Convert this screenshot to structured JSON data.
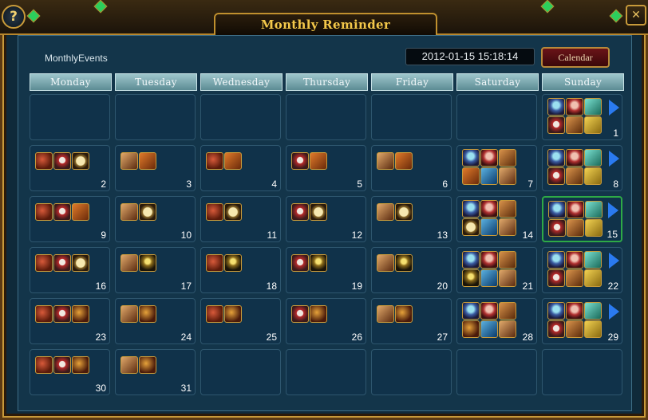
{
  "window": {
    "title": "Monthly Reminder"
  },
  "header": {
    "events_label": "MonthlyEvents",
    "datetime": "2012-01-15 15:18:14",
    "calendar_button": "Calendar"
  },
  "days_of_week": [
    "Monday",
    "Tuesday",
    "Wednesday",
    "Thursday",
    "Friday",
    "Saturday",
    "Sunday"
  ],
  "icon_legend": {
    "i-bomb": "bomb-icon",
    "i-shield": "shield-icon",
    "i-clock": "clock-icon",
    "i-chest": "chest-icon",
    "i-gift": "gift-icon",
    "i-candle": "candle-icon",
    "i-bomb2": "firework-icon",
    "i-orb": "orb-icon",
    "i-girl": "npc-girl-icon",
    "i-statue": "statue-icon",
    "i-bag": "bag-icon",
    "i-dragon": "dragon-icon",
    "i-gold": "gold-icon"
  },
  "today": 15,
  "weeks": [
    [
      {
        "day": null,
        "icons": []
      },
      {
        "day": null,
        "icons": []
      },
      {
        "day": null,
        "icons": []
      },
      {
        "day": null,
        "icons": []
      },
      {
        "day": null,
        "icons": []
      },
      {
        "day": null,
        "icons": []
      },
      {
        "day": 1,
        "icons": [
          "i-orb",
          "i-girl",
          "i-statue",
          "i-shield",
          "i-bag",
          "i-gold"
        ],
        "more": true
      }
    ],
    [
      {
        "day": 2,
        "icons": [
          "i-bomb",
          "i-shield",
          "i-clock"
        ]
      },
      {
        "day": 3,
        "icons": [
          "i-gift",
          "i-chest"
        ]
      },
      {
        "day": 4,
        "icons": [
          "i-bomb",
          "i-chest"
        ]
      },
      {
        "day": 5,
        "icons": [
          "i-shield",
          "i-chest"
        ]
      },
      {
        "day": 6,
        "icons": [
          "i-gift",
          "i-chest"
        ]
      },
      {
        "day": 7,
        "icons": [
          "i-orb",
          "i-girl",
          "i-bag",
          "i-chest",
          "i-dragon",
          "i-gift"
        ]
      },
      {
        "day": 8,
        "icons": [
          "i-orb",
          "i-girl",
          "i-statue",
          "i-shield",
          "i-bag",
          "i-gold"
        ],
        "more": true
      }
    ],
    [
      {
        "day": 9,
        "icons": [
          "i-bomb",
          "i-shield",
          "i-chest"
        ]
      },
      {
        "day": 10,
        "icons": [
          "i-gift",
          "i-clock"
        ]
      },
      {
        "day": 11,
        "icons": [
          "i-bomb",
          "i-clock"
        ]
      },
      {
        "day": 12,
        "icons": [
          "i-shield",
          "i-clock"
        ]
      },
      {
        "day": 13,
        "icons": [
          "i-gift",
          "i-clock"
        ]
      },
      {
        "day": 14,
        "icons": [
          "i-orb",
          "i-girl",
          "i-bag",
          "i-clock",
          "i-dragon",
          "i-gift"
        ]
      },
      {
        "day": 15,
        "icons": [
          "i-orb",
          "i-girl",
          "i-statue",
          "i-shield",
          "i-bag",
          "i-gold"
        ],
        "more": true
      }
    ],
    [
      {
        "day": 16,
        "icons": [
          "i-bomb",
          "i-shield",
          "i-clock"
        ]
      },
      {
        "day": 17,
        "icons": [
          "i-gift",
          "i-candle"
        ]
      },
      {
        "day": 18,
        "icons": [
          "i-bomb",
          "i-candle"
        ]
      },
      {
        "day": 19,
        "icons": [
          "i-shield",
          "i-candle"
        ]
      },
      {
        "day": 20,
        "icons": [
          "i-gift",
          "i-candle"
        ]
      },
      {
        "day": 21,
        "icons": [
          "i-orb",
          "i-girl",
          "i-bag",
          "i-candle",
          "i-dragon",
          "i-gift"
        ]
      },
      {
        "day": 22,
        "icons": [
          "i-orb",
          "i-girl",
          "i-statue",
          "i-shield",
          "i-bag",
          "i-gold"
        ],
        "more": true
      }
    ],
    [
      {
        "day": 23,
        "icons": [
          "i-bomb",
          "i-shield",
          "i-bomb2"
        ]
      },
      {
        "day": 24,
        "icons": [
          "i-gift",
          "i-bomb2"
        ]
      },
      {
        "day": 25,
        "icons": [
          "i-bomb",
          "i-bomb2"
        ]
      },
      {
        "day": 26,
        "icons": [
          "i-shield",
          "i-bomb2"
        ]
      },
      {
        "day": 27,
        "icons": [
          "i-gift",
          "i-bomb2"
        ]
      },
      {
        "day": 28,
        "icons": [
          "i-orb",
          "i-girl",
          "i-bag",
          "i-bomb2",
          "i-dragon",
          "i-gift"
        ]
      },
      {
        "day": 29,
        "icons": [
          "i-orb",
          "i-girl",
          "i-statue",
          "i-shield",
          "i-bag",
          "i-gold"
        ],
        "more": true
      }
    ],
    [
      {
        "day": 30,
        "icons": [
          "i-bomb",
          "i-shield",
          "i-bomb2"
        ]
      },
      {
        "day": 31,
        "icons": [
          "i-gift",
          "i-bomb2"
        ]
      },
      {
        "day": null,
        "icons": []
      },
      {
        "day": null,
        "icons": []
      },
      {
        "day": null,
        "icons": []
      },
      {
        "day": null,
        "icons": []
      },
      {
        "day": null,
        "icons": []
      }
    ]
  ]
}
